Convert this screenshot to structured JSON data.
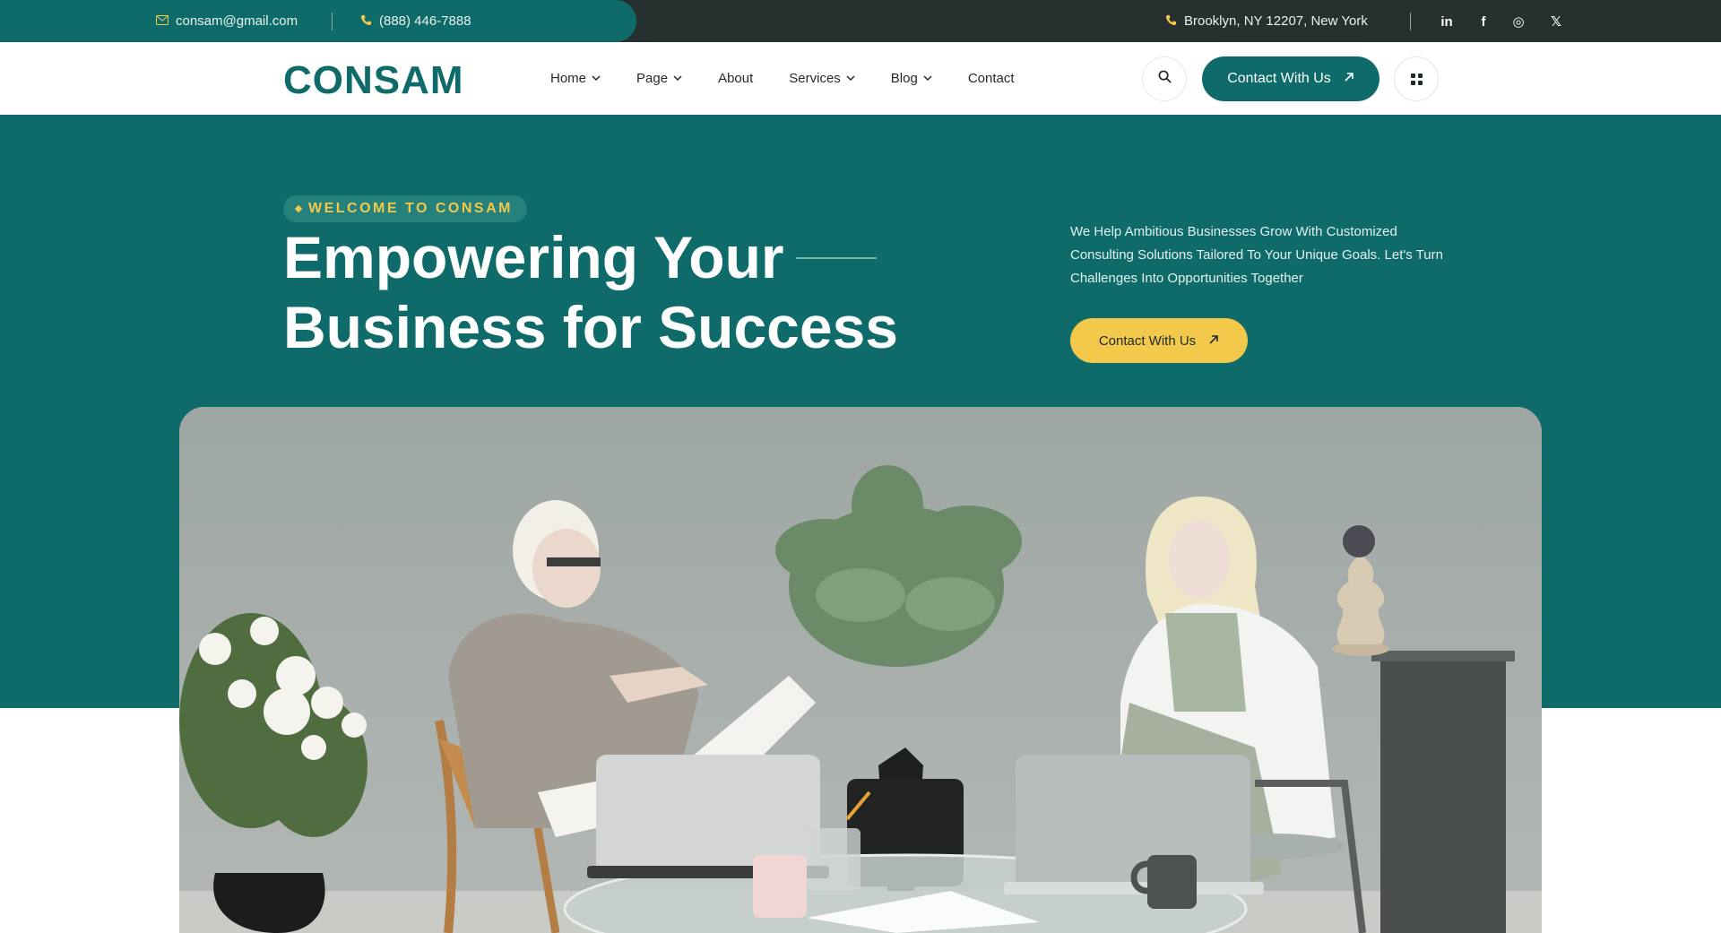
{
  "topbar": {
    "email": "consam@gmail.com",
    "phone": "(888) 446-7888",
    "address": "Brooklyn, NY 12207, New York",
    "socials": [
      {
        "name": "linkedin-icon",
        "glyph": "in"
      },
      {
        "name": "facebook-icon",
        "glyph": "f"
      },
      {
        "name": "instagram-icon",
        "glyph": "◎"
      },
      {
        "name": "x-icon",
        "glyph": "𝕏"
      }
    ]
  },
  "header": {
    "logo": "CONSAM",
    "nav": [
      {
        "label": "Home",
        "has_dropdown": true
      },
      {
        "label": "Page",
        "has_dropdown": true
      },
      {
        "label": "About",
        "has_dropdown": false
      },
      {
        "label": "Services",
        "has_dropdown": true
      },
      {
        "label": "Blog",
        "has_dropdown": true
      },
      {
        "label": "Contact",
        "has_dropdown": false
      }
    ],
    "cta_label": "Contact With Us"
  },
  "hero": {
    "badge": "WELCOME TO CONSAM",
    "title_line1": "Empowering Your",
    "title_line2": "Business for Success",
    "description": "We Help Ambitious Businesses Grow With Customized Consulting Solutions Tailored To Your Unique Goals. Let's Turn Challenges Into Opportunities Together",
    "cta_label": "Contact With Us"
  },
  "colors": {
    "primary": "#0e6b69",
    "accent": "#f3c94c",
    "dark": "#25302f"
  }
}
